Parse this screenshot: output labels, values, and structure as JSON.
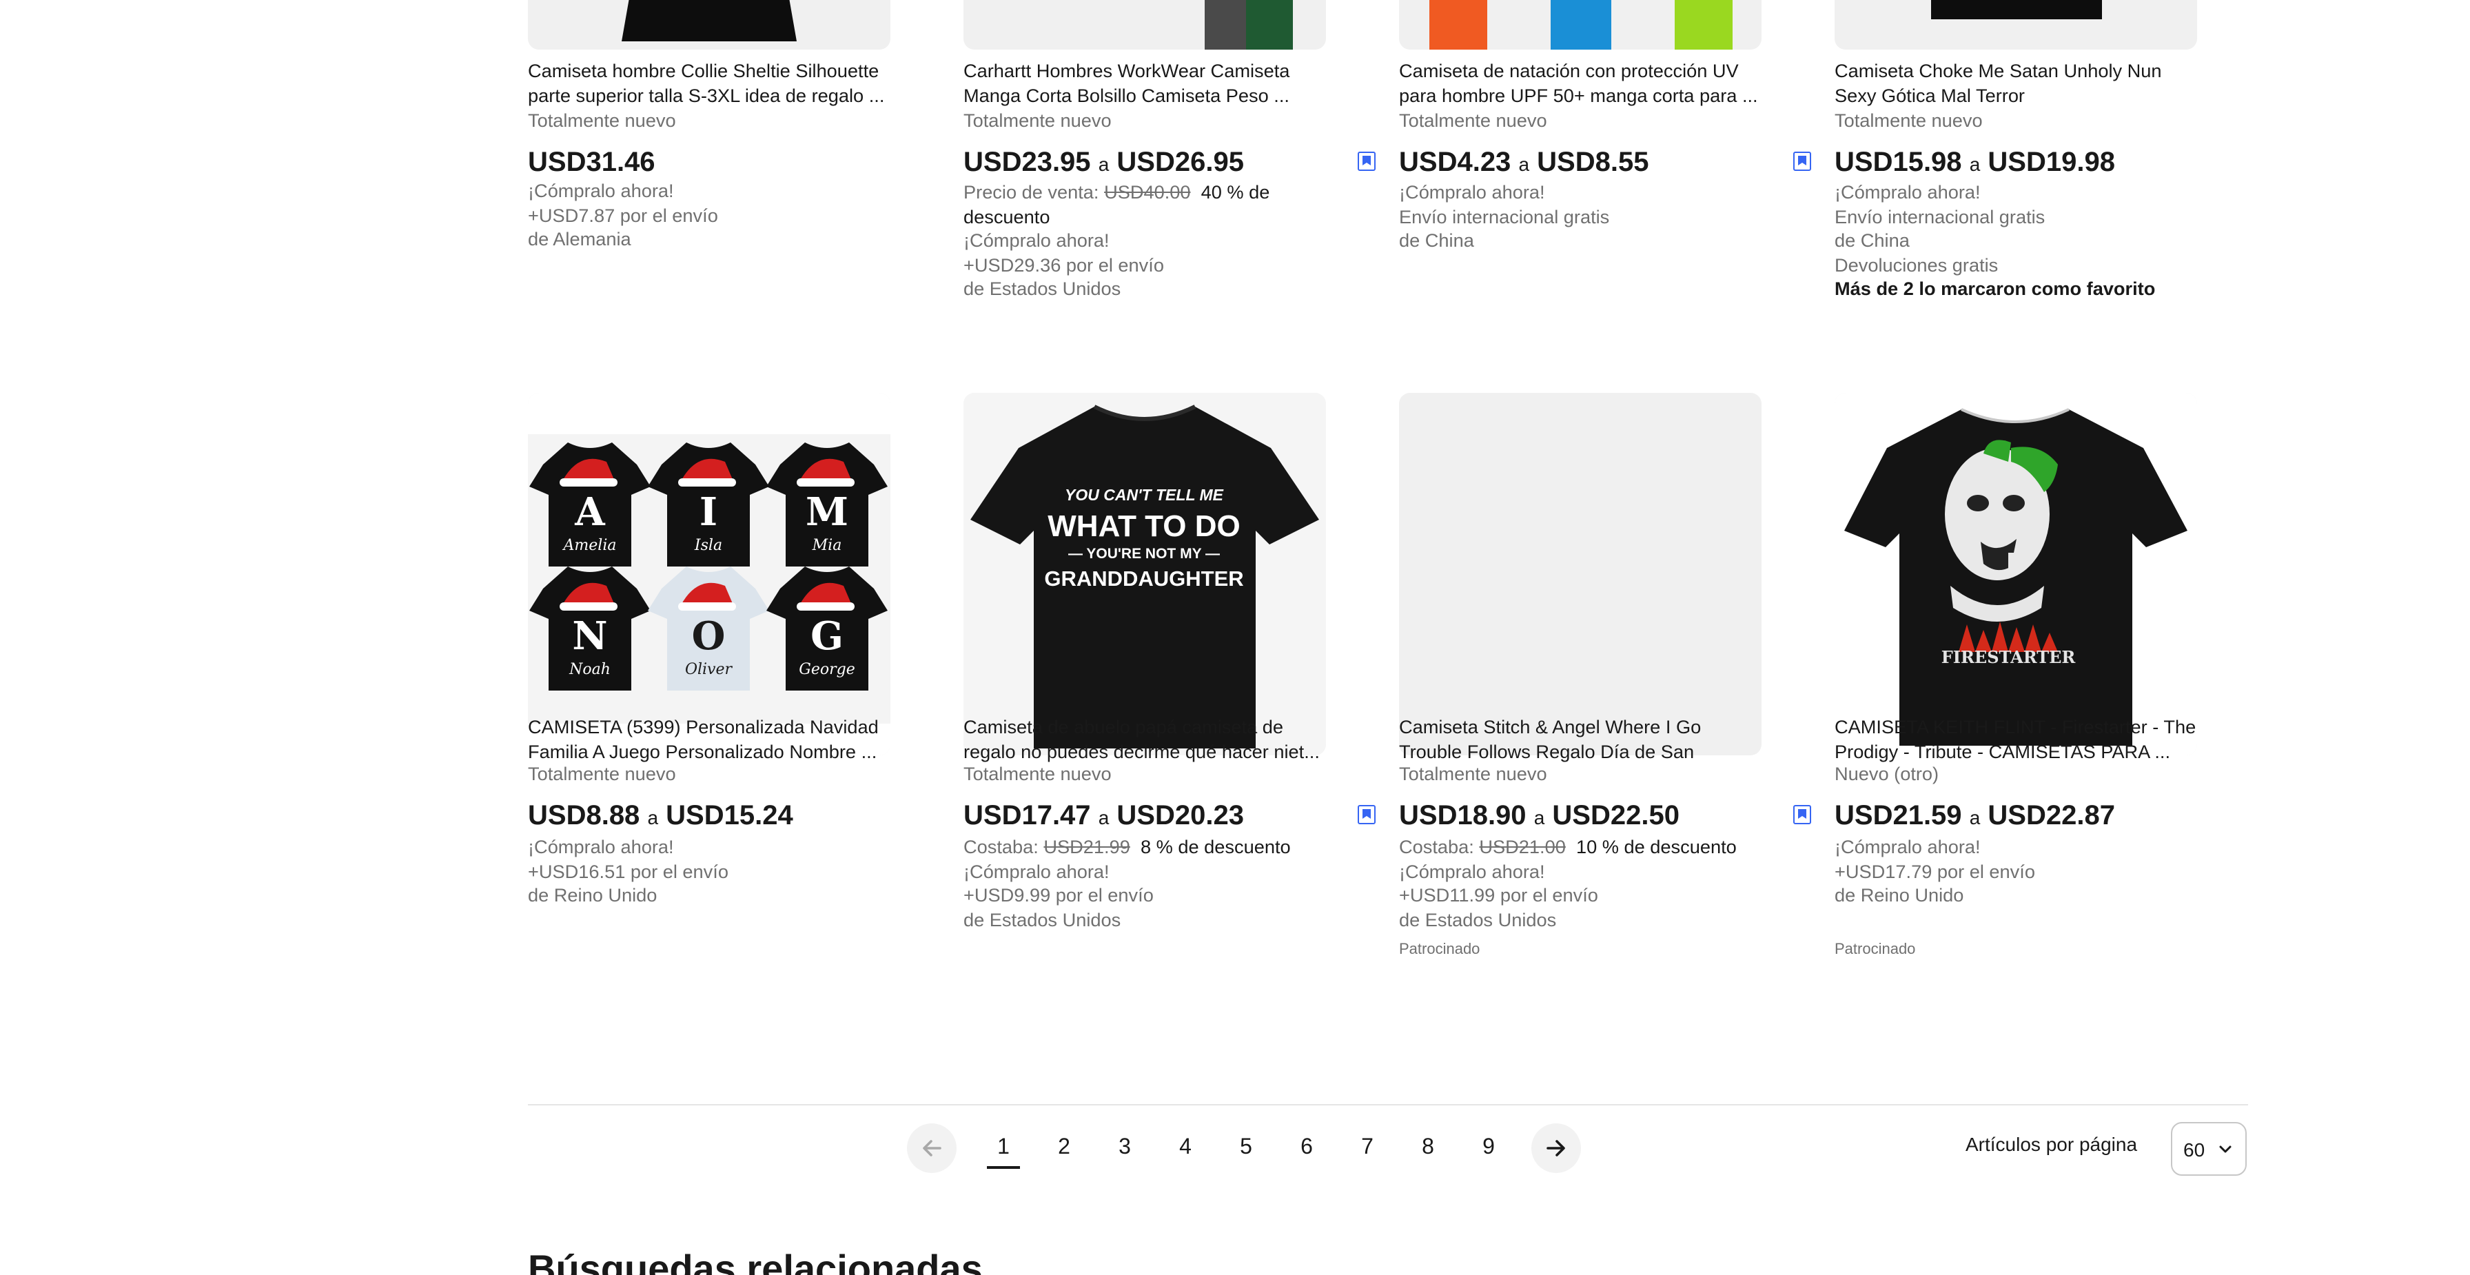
{
  "products": [
    {
      "title": "Camiseta hombre Collie Sheltie Silhouette parte superior talla S-3XL idea de regalo ...",
      "condition": "Totalmente nuevo",
      "price_low": "USD31.46",
      "price_sep": "",
      "price_high": "",
      "line1": "¡Cómpralo ahora!",
      "line2": "+USD7.87 por el envío",
      "line3": "de Alemania"
    },
    {
      "title": "Carhartt Hombres WorkWear Camiseta Manga Corta Bolsillo Camiseta Peso ...",
      "condition": "Totalmente nuevo",
      "price_low": "USD23.95",
      "price_sep": "a",
      "price_high": "USD26.95",
      "was_label": "Precio de venta:",
      "was_price": "USD40.00",
      "discount": "40 % de descuento",
      "line1": "¡Cómpralo ahora!",
      "line2": "+USD29.36 por el envío",
      "line3": "de Estados Unidos"
    },
    {
      "title": "Camiseta de natación con protección UV para hombre UPF 50+ manga corta para ...",
      "condition": "Totalmente nuevo",
      "price_low": "USD4.23",
      "price_sep": "a",
      "price_high": "USD8.55",
      "line1": "¡Cómpralo ahora!",
      "line2": "Envío internacional gratis",
      "line3": "de China"
    },
    {
      "title": "Camiseta Choke Me Satan Unholy Nun Sexy Gótica Mal Terror",
      "condition": "Totalmente nuevo",
      "price_low": "USD15.98",
      "price_sep": "a",
      "price_high": "USD19.98",
      "line1": "¡Cómpralo ahora!",
      "line2": "Envío internacional gratis",
      "line3": "de China",
      "line4": "Devoluciones gratis",
      "line5": "Más de 2 lo marcaron como favorito"
    },
    {
      "title": "CAMISETA (5399) Personalizada Navidad Familia A Juego Personalizado Nombre ...",
      "condition": "Totalmente nuevo",
      "price_low": "USD8.88",
      "price_sep": "a",
      "price_high": "USD15.24",
      "line1": "¡Cómpralo ahora!",
      "line2": "+USD16.51 por el envío",
      "line3": "de Reino Unido",
      "names": [
        "Amelia",
        "Isla",
        "Mia",
        "Noah",
        "Oliver",
        "George"
      ],
      "letters": [
        "A",
        "I",
        "M",
        "N",
        "O",
        "G"
      ]
    },
    {
      "title": "Camiseta de abuelo papá camiseta de regalo no puedes decirme qué hacer niet...",
      "condition": "Totalmente nuevo",
      "price_low": "USD17.47",
      "price_sep": "a",
      "price_high": "USD20.23",
      "was_label": "Costaba:",
      "was_price": "USD21.99",
      "discount": "8 % de descuento",
      "line1": "¡Cómpralo ahora!",
      "line2": "+USD9.99 por el envío",
      "line3": "de Estados Unidos",
      "shirt_text": [
        "YOU CAN'T TELL ME",
        "WHAT TO DO",
        "— YOU'RE NOT MY —",
        "GRANDDAUGHTER"
      ]
    },
    {
      "title": "Camiseta Stitch & Angel Where I Go Trouble Follows Regalo Día de San Valentí...",
      "condition": "Totalmente nuevo",
      "price_low": "USD18.90",
      "price_sep": "a",
      "price_high": "USD22.50",
      "was_label": "Costaba:",
      "was_price": "USD21.00",
      "discount": "10 % de descuento",
      "line1": "¡Cómpralo ahora!",
      "line2": "+USD11.99 por el envío",
      "line3": "de Estados Unidos",
      "sponsored": "Patrocinado"
    },
    {
      "title": "CAMISETA KEITH FLINT - Firestarter - The Prodigy - Tribute - CAMISETAS PARA ...",
      "condition": "Nuevo (otro)",
      "price_low": "USD21.59",
      "price_sep": "a",
      "price_high": "USD22.87",
      "line1": "¡Cómpralo ahora!",
      "line2": "+USD17.79 por el envío",
      "line3": "de Reino Unido",
      "sponsored": "Patrocinado",
      "shirt_text": "FIRESTARTER"
    }
  ],
  "pagination": {
    "pages": [
      "1",
      "2",
      "3",
      "4",
      "5",
      "6",
      "7",
      "8",
      "9"
    ],
    "current": "1",
    "items_per_page_label": "Artículos por página",
    "items_per_page_value": "60"
  },
  "related_heading": "Búsquedas relacionadas",
  "colors": {
    "text": "#191919",
    "muted": "#707070",
    "badge": "#3665f3",
    "divider": "#e5e5e5"
  }
}
